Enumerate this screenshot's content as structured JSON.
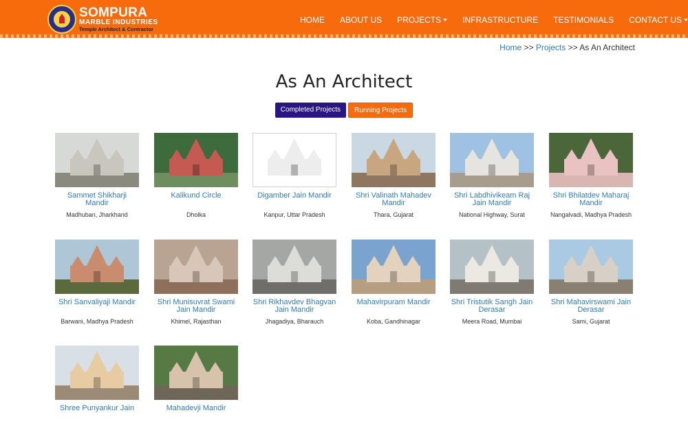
{
  "brand": {
    "name": "SOMPURA",
    "subtitle": "MARBLE INDUSTRIES",
    "tagline": "Temple Architect & Contractor",
    "primary_color": "#f76b0c",
    "secondary_color": "#2a1682",
    "link_color": "#337ab7"
  },
  "nav": {
    "items": [
      {
        "label": "HOME",
        "dropdown": false
      },
      {
        "label": "ABOUT US",
        "dropdown": false
      },
      {
        "label": "PROJECTS",
        "dropdown": true
      },
      {
        "label": "INFRASTRUCTURE",
        "dropdown": false
      },
      {
        "label": "TESTIMONIALS",
        "dropdown": false
      },
      {
        "label": "CONTACT US",
        "dropdown": true
      }
    ]
  },
  "breadcrumb": {
    "home": "Home",
    "sep1": ">>",
    "projects": "Projects",
    "sep2": ">>",
    "current": "As An Architect"
  },
  "page": {
    "title": "As An Architect"
  },
  "filters": {
    "completed": "Completed Projects",
    "running": "Running Projects"
  },
  "projects": [
    {
      "title": "Sammet Shikharji Mandir",
      "location": "Madhuban, Jharkhand",
      "sky": "#d7d9d7",
      "ground": "#8a8a7e",
      "temple": "#c9c6bd"
    },
    {
      "title": "Kalikund Circle",
      "location": "Dholka",
      "sky": "#3e6b3c",
      "ground": "#6f8e5f",
      "temple": "#c55a53"
    },
    {
      "title": "Digamber Jain Mandir",
      "location": "Kanpur, Uttar Pradesh",
      "sky": "#ffffff",
      "ground": "#ffffff",
      "temple": "#ededed"
    },
    {
      "title": "Shri Valinath Mahadev Mandir",
      "location": "Thara, Gujarat",
      "sky": "#c9d8e3",
      "ground": "#8f7660",
      "temple": "#c8a780"
    },
    {
      "title": "Shri Labdhivikeam Raj Jain Mandir",
      "location": "National Highway, Surat",
      "sky": "#9fc2e3",
      "ground": "#a89d8d",
      "temple": "#e6e4de"
    },
    {
      "title": "Shri Bhilatdev Maharaj Mandir",
      "location": "Nangalvadi, Madhya Pradesh",
      "sky": "#4b6638",
      "ground": "#d9b6b1",
      "temple": "#e9c3c2"
    },
    {
      "title": "Shri Sanvaliyaji Mandir",
      "location": "Barwani, Madhya Pradesh",
      "sky": "#aec7d7",
      "ground": "#5a6a3c",
      "temple": "#c98c6e"
    },
    {
      "title": "Shri Munisuvrat Swami Jain Mandir",
      "location": "Khimel, Rajasthan",
      "sky": "#b9a393",
      "ground": "#8d6f5b",
      "temple": "#d8c6b8"
    },
    {
      "title": "Shri Rikhavdev Bhagvan Jain Mandir",
      "location": "Jhagadiya, Bharauch",
      "sky": "#a5a7a5",
      "ground": "#6f6e6a",
      "temple": "#dcdcd8"
    },
    {
      "title": "Mahavirpuram Mandir",
      "location": "Koba, Gandhinagar",
      "sky": "#7aa3cf",
      "ground": "#b69e82",
      "temple": "#e3d2bd"
    },
    {
      "title": "Shri Tristutik Sangh Jain Derasar",
      "location": "Meera Road, Mumbai",
      "sky": "#b4c1c6",
      "ground": "#7f7b72",
      "temple": "#ebe9e2"
    },
    {
      "title": "Shri Mahavirswami Jain Derasar",
      "location": "Sami, Gujarat",
      "sky": "#aac9e3",
      "ground": "#8a8072",
      "temple": "#d6d0c7"
    },
    {
      "title": "Shree Punyankur Jain",
      "location": "",
      "sky": "#d8dfe6",
      "ground": "#9a8a76",
      "temple": "#e7cba3"
    },
    {
      "title": "Mahadevji Mandir",
      "location": "",
      "sky": "#557a44",
      "ground": "#6e6657",
      "temple": "#d7c2ac"
    }
  ]
}
